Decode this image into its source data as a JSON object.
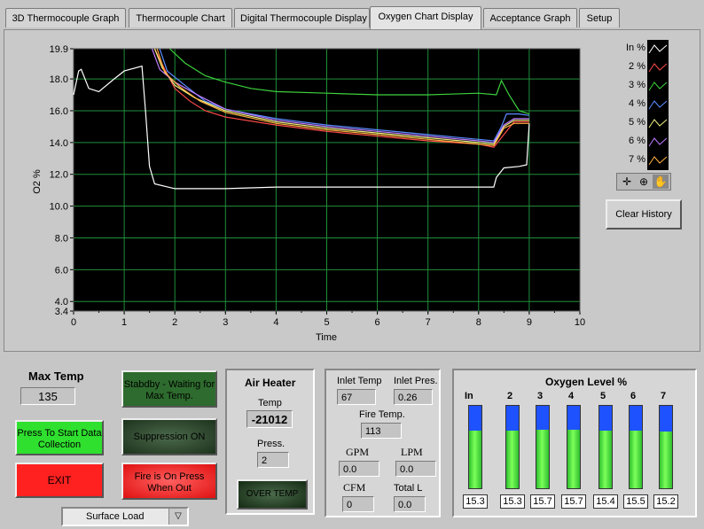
{
  "tabs": [
    {
      "label": "3D Thermocouple Graph",
      "active": false
    },
    {
      "label": "Thermocouple Chart",
      "active": false
    },
    {
      "label": "Digital Thermocouple Display",
      "active": false
    },
    {
      "label": "Oxygen Chart Display",
      "active": true
    },
    {
      "label": "Acceptance Graph",
      "active": false
    },
    {
      "label": "Setup",
      "active": false
    }
  ],
  "chart_data": {
    "type": "line",
    "xlabel": "Time",
    "ylabel": "O2 %",
    "xlim": [
      0,
      10
    ],
    "ylim": [
      3.4,
      19.9
    ],
    "x_ticks": [
      "0",
      "1",
      "2",
      "3",
      "4",
      "5",
      "6",
      "7",
      "8",
      "9",
      "10"
    ],
    "y_ticks": [
      "19.9",
      "18.0",
      "16.0",
      "14.0",
      "12.0",
      "10.0",
      "8.0",
      "6.0",
      "4.0",
      "3.4"
    ],
    "background": "#000000",
    "grid_color": "#1f8f3a",
    "grid": true,
    "series": [
      {
        "name": "In %",
        "color": "#ffffff",
        "points": [
          [
            0,
            17.0
          ],
          [
            0.1,
            18.5
          ],
          [
            0.15,
            18.6
          ],
          [
            0.3,
            17.4
          ],
          [
            0.5,
            17.2
          ],
          [
            0.8,
            18.0
          ],
          [
            1.0,
            18.5
          ],
          [
            1.35,
            18.8
          ],
          [
            1.42,
            16.0
          ],
          [
            1.5,
            12.5
          ],
          [
            1.6,
            11.4
          ],
          [
            2.0,
            11.1
          ],
          [
            3.0,
            11.1
          ],
          [
            4.0,
            11.2
          ],
          [
            5.0,
            11.2
          ],
          [
            6.0,
            11.2
          ],
          [
            7.0,
            11.2
          ],
          [
            8.0,
            11.2
          ],
          [
            8.3,
            11.2
          ],
          [
            8.35,
            11.8
          ],
          [
            8.5,
            12.4
          ],
          [
            8.8,
            12.5
          ],
          [
            8.95,
            12.6
          ],
          [
            9.0,
            15.2
          ]
        ]
      },
      {
        "name": "2 %",
        "color": "#ff4a4a",
        "points": [
          [
            1.6,
            19.9
          ],
          [
            1.8,
            18.6
          ],
          [
            2.0,
            17.4
          ],
          [
            2.3,
            16.6
          ],
          [
            2.6,
            16.0
          ],
          [
            3.0,
            15.6
          ],
          [
            4.0,
            15.1
          ],
          [
            5.0,
            14.7
          ],
          [
            6.0,
            14.4
          ],
          [
            7.0,
            14.1
          ],
          [
            8.0,
            13.9
          ],
          [
            8.3,
            13.7
          ],
          [
            8.5,
            14.5
          ],
          [
            8.7,
            15.3
          ],
          [
            9.0,
            15.3
          ]
        ]
      },
      {
        "name": "3 %",
        "color": "#3cd23c",
        "points": [
          [
            1.9,
            19.9
          ],
          [
            2.2,
            19.0
          ],
          [
            2.6,
            18.2
          ],
          [
            3.0,
            17.8
          ],
          [
            3.5,
            17.4
          ],
          [
            4.0,
            17.2
          ],
          [
            5.0,
            17.1
          ],
          [
            6.0,
            17.0
          ],
          [
            7.0,
            17.0
          ],
          [
            8.0,
            17.1
          ],
          [
            8.35,
            17.0
          ],
          [
            8.45,
            17.9
          ],
          [
            8.6,
            17.0
          ],
          [
            8.8,
            16.0
          ],
          [
            9.0,
            15.8
          ]
        ]
      },
      {
        "name": "4 %",
        "color": "#5a8cff",
        "points": [
          [
            1.7,
            19.9
          ],
          [
            1.85,
            18.5
          ],
          [
            2.2,
            17.6
          ],
          [
            2.6,
            16.6
          ],
          [
            3.0,
            16.1
          ],
          [
            4.0,
            15.5
          ],
          [
            5.0,
            15.1
          ],
          [
            6.0,
            14.8
          ],
          [
            7.0,
            14.5
          ],
          [
            8.0,
            14.2
          ],
          [
            8.3,
            14.1
          ],
          [
            8.45,
            15.0
          ],
          [
            8.55,
            15.8
          ],
          [
            8.8,
            15.8
          ],
          [
            9.0,
            15.7
          ]
        ]
      },
      {
        "name": "5 %",
        "color": "#f0f080",
        "points": [
          [
            1.6,
            19.9
          ],
          [
            1.75,
            18.7
          ],
          [
            2.0,
            17.6
          ],
          [
            2.4,
            16.8
          ],
          [
            3.0,
            16.0
          ],
          [
            4.0,
            15.3
          ],
          [
            5.0,
            14.9
          ],
          [
            6.0,
            14.6
          ],
          [
            7.0,
            14.3
          ],
          [
            8.0,
            14.0
          ],
          [
            8.3,
            13.9
          ],
          [
            8.5,
            15.0
          ],
          [
            8.7,
            15.4
          ],
          [
            9.0,
            15.4
          ]
        ]
      },
      {
        "name": "6 %",
        "color": "#c07cff",
        "points": [
          [
            1.55,
            19.9
          ],
          [
            1.7,
            18.6
          ],
          [
            2.0,
            17.8
          ],
          [
            2.5,
            16.9
          ],
          [
            3.0,
            16.1
          ],
          [
            4.0,
            15.4
          ],
          [
            5.0,
            15.0
          ],
          [
            6.0,
            14.7
          ],
          [
            7.0,
            14.4
          ],
          [
            8.0,
            14.1
          ],
          [
            8.3,
            14.0
          ],
          [
            8.5,
            15.1
          ],
          [
            8.7,
            15.5
          ],
          [
            9.0,
            15.5
          ]
        ]
      },
      {
        "name": "7 %",
        "color": "#ffb040",
        "points": [
          [
            1.65,
            19.9
          ],
          [
            1.8,
            18.4
          ],
          [
            2.1,
            17.5
          ],
          [
            2.5,
            16.6
          ],
          [
            3.0,
            15.9
          ],
          [
            4.0,
            15.2
          ],
          [
            5.0,
            14.8
          ],
          [
            6.0,
            14.5
          ],
          [
            7.0,
            14.2
          ],
          [
            8.0,
            13.9
          ],
          [
            8.3,
            13.8
          ],
          [
            8.5,
            14.9
          ],
          [
            8.7,
            15.2
          ],
          [
            9.0,
            15.2
          ]
        ]
      }
    ]
  },
  "palette_icons": [
    "crosshair-icon",
    "zoom-icon",
    "hand-icon"
  ],
  "clear_history_label": "Clear History",
  "max_temp": {
    "title": "Max Temp",
    "value": "135"
  },
  "start_button": {
    "label": "Press To Start Data Collection"
  },
  "exit_button": {
    "label": "EXIT"
  },
  "status_buttons": [
    {
      "label": "Stabdby - Waiting for Max Temp."
    },
    {
      "label": "Suppression ON"
    },
    {
      "label": "Fire is On Press When Out"
    }
  ],
  "air_heater": {
    "title": "Air Heater",
    "temp_label": "Temp",
    "temp_value": "-21012",
    "press_label": "Press.",
    "press_value": "2",
    "over_temp_label": "OVER TEMP"
  },
  "process": {
    "inlet_temp_label": "Inlet Temp",
    "inlet_temp_value": "67",
    "inlet_pres_label": "Inlet Pres.",
    "inlet_pres_value": "0.26",
    "fire_temp_label": "Fire Temp.",
    "fire_temp_value": "113",
    "gpm_label": "GPM",
    "gpm_value": "0.0",
    "lpm_label": "LPM",
    "lpm_value": "0.0",
    "cfm_label": "CFM",
    "cfm_value": "0",
    "total_label": "Total L",
    "total_value": "0.0"
  },
  "oxygen_level": {
    "title": "Oxygen Level %",
    "tanks": [
      {
        "label": "In",
        "value": "15.3",
        "level": 0.7
      },
      {
        "label": "2",
        "value": "15.3",
        "level": 0.7
      },
      {
        "label": "3",
        "value": "15.7",
        "level": 0.71
      },
      {
        "label": "4",
        "value": "15.7",
        "level": 0.71
      },
      {
        "label": "5",
        "value": "15.4",
        "level": 0.7
      },
      {
        "label": "6",
        "value": "15.5",
        "level": 0.7
      },
      {
        "label": "7",
        "value": "15.2",
        "level": 0.69
      }
    ]
  },
  "surface_load": {
    "value": "Surface Load"
  }
}
